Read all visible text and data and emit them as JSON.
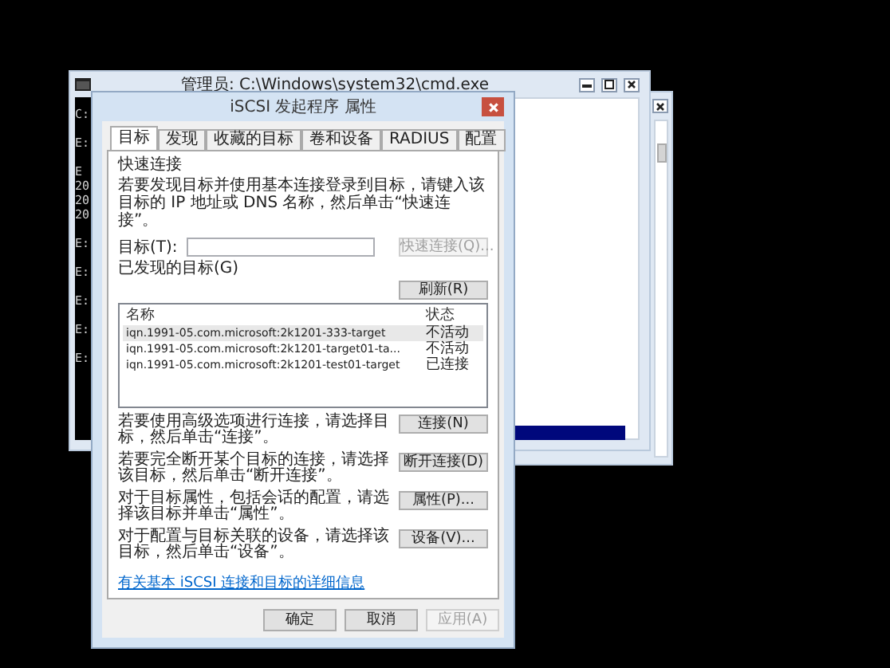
{
  "console_window": {
    "title": "管理员: C:\\Windows\\system32\\cmd.exe",
    "paragraphs": [
      [
        "C:"
      ],
      [
        "E:"
      ],
      [
        "E",
        "20",
        "20",
        "20"
      ],
      [
        "E:"
      ],
      [
        "E:"
      ],
      [
        "E:"
      ],
      [
        "E:"
      ],
      [
        "E:"
      ]
    ]
  },
  "dialog": {
    "title": "iSCSI 发起程序 属性",
    "tabs": [
      {
        "label": "目标",
        "selected": true
      },
      {
        "label": "发现",
        "selected": false
      },
      {
        "label": "收藏的目标",
        "selected": false
      },
      {
        "label": "卷和设备",
        "selected": false
      },
      {
        "label": "RADIUS",
        "selected": false
      },
      {
        "label": "配置",
        "selected": false
      }
    ],
    "quick_connect": {
      "heading": "快速连接",
      "description": "若要发现目标并使用基本连接登录到目标，请键入该目标的 IP 地址或 DNS 名称，然后单击“快速连接”。",
      "target_label": "目标(T):",
      "button": {
        "label": "快速连接(Q)...",
        "disabled": true
      }
    },
    "discovered": {
      "heading": "已发现的目标(G)",
      "refresh_button": "刷新(R)",
      "columns": [
        "名称",
        "状态"
      ],
      "rows": [
        {
          "name": "iqn.1991-05.com.microsoft:2k1201-333-target",
          "status": "不活动",
          "selected": true
        },
        {
          "name": "iqn.1991-05.com.microsoft:2k1201-target01-ta...",
          "status": "不活动",
          "selected": false
        },
        {
          "name": "iqn.1991-05.com.microsoft:2k1201-test01-target",
          "status": "已连接",
          "selected": false
        }
      ]
    },
    "actions": [
      {
        "description": "若要使用高级选项进行连接，请选择目标，然后单击“连接”。",
        "button": "连接(N)"
      },
      {
        "description": "若要完全断开某个目标的连接，请选择该目标，然后单击“断开连接”。",
        "button": "断开连接(D)"
      },
      {
        "description": "对于目标属性，包括会话的配置，请选择该目标并单击“属性”。",
        "button": "属性(P)..."
      },
      {
        "description": "对于配置与目标关联的设备，请选择该目标，然后单击“设备”。",
        "button": "设备(V)..."
      }
    ],
    "link": "有关基本 iSCSI 连接和目标的详细信息",
    "buttons": [
      {
        "label": "确定",
        "disabled": false
      },
      {
        "label": "取消",
        "disabled": false
      },
      {
        "label": "应用(A)",
        "disabled": true
      }
    ]
  }
}
